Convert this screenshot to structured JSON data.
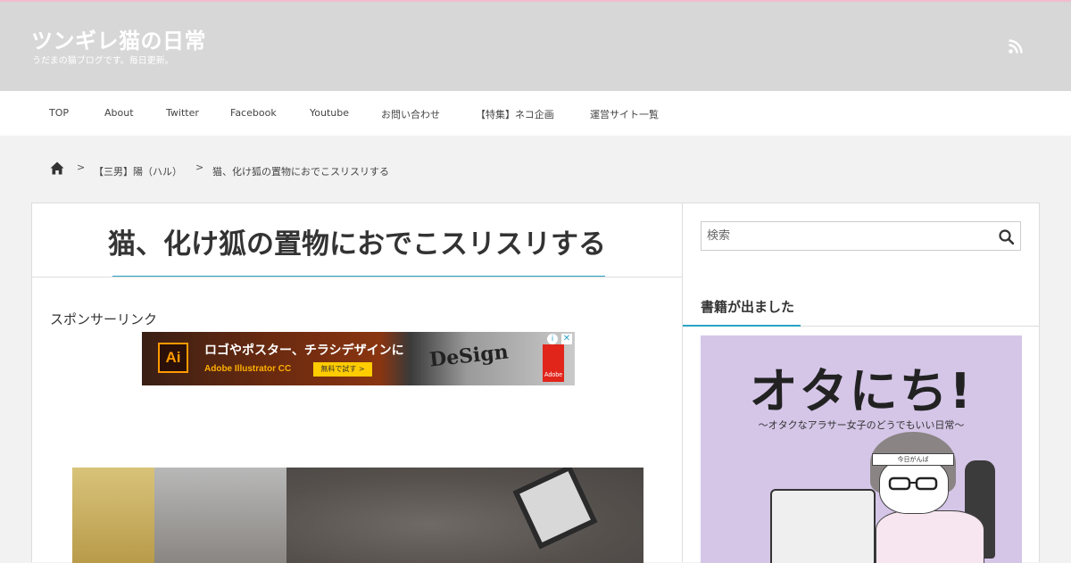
{
  "site": {
    "title": "ツンギレ猫の日常",
    "description": "うだまの猫ブログです。毎日更新。"
  },
  "nav": {
    "items": [
      {
        "label": "TOP"
      },
      {
        "label": "About"
      },
      {
        "label": "Twitter"
      },
      {
        "label": "Facebook"
      },
      {
        "label": "Youtube"
      },
      {
        "label": "お問い合わせ"
      },
      {
        "label": "【特集】ネコ企画"
      },
      {
        "label": "運営サイト一覧"
      }
    ]
  },
  "breadcrumb": {
    "category": "【三男】陽（ハル）",
    "current": "猫、化け狐の置物におでこスリスリする",
    "separator": ">"
  },
  "post": {
    "title": "猫、化け狐の置物におでこスリスリする",
    "sponsor_label": "スポンサーリンク"
  },
  "ad": {
    "logo": "Ai",
    "headline": "ロゴやポスター、チラシデザインに",
    "subline": "Adobe Illustrator CC",
    "cta": "無料で試す >",
    "design_text": "DeSign",
    "brand": "Adobe",
    "info": "i",
    "close": "✕"
  },
  "sidebar": {
    "search": {
      "placeholder": "検索"
    },
    "widget_title": "書籍が出ました",
    "book": {
      "title": "オタにち!",
      "subtitle": "～オタクなアラサー女子のどうでもいい日常～",
      "headband": "今日がんば"
    }
  },
  "colors": {
    "accent": "#2aa3c4",
    "header_bg": "#d7d7d7",
    "top_line": "#f3bcd0",
    "page_bg": "#f2f2f2"
  }
}
